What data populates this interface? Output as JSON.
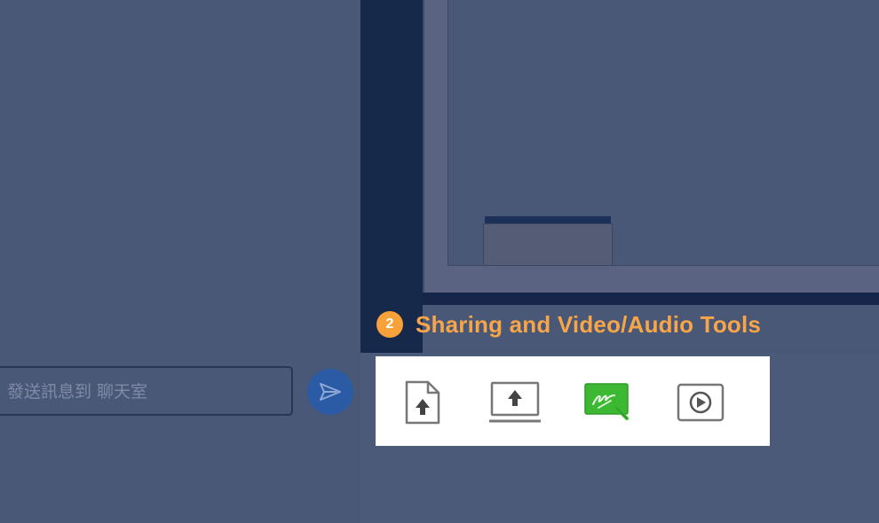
{
  "section": {
    "badge_number": "2",
    "title": "Sharing and Video/Audio Tools",
    "accent_color": "#f7a13a"
  },
  "chat": {
    "placeholder": "發送訊息到 聊天室",
    "send_icon": "send-arrow-icon"
  },
  "toolbar": {
    "tools": [
      {
        "icon": "upload-file-icon"
      },
      {
        "icon": "share-screen-icon"
      },
      {
        "icon": "whiteboard-icon",
        "color": "#3cb832"
      },
      {
        "icon": "play-media-icon"
      }
    ]
  },
  "colors": {
    "overlay_bg": "#4a5877",
    "board_frame": "#17294a",
    "send_button": "#2b5ba4"
  }
}
